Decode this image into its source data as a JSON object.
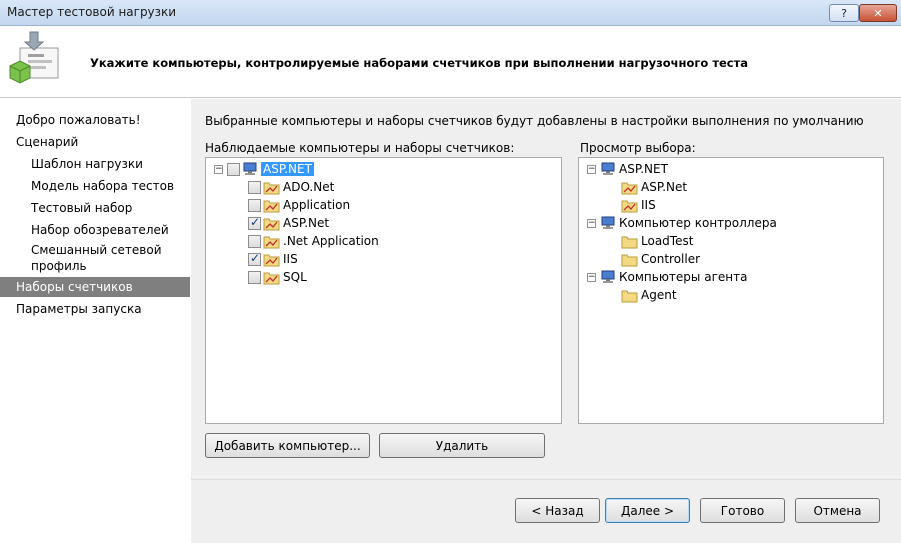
{
  "window": {
    "title": "Мастер тестовой нагрузки",
    "help_label": "?",
    "close_label": "✕"
  },
  "header": {
    "heading": "Укажите компьютеры, контролируемые наборами счетчиков при выполнении нагрузочного теста"
  },
  "nav": {
    "items": [
      {
        "label": "Добро пожаловать!"
      },
      {
        "label": "Сценарий"
      },
      {
        "label": "Шаблон нагрузки"
      },
      {
        "label": "Модель набора тестов"
      },
      {
        "label": "Тестовый набор"
      },
      {
        "label": "Набор обозревателей"
      },
      {
        "label": "Смешанный сетевой"
      },
      {
        "label": "профиль"
      },
      {
        "label": "Наборы счетчиков"
      },
      {
        "label": "Параметры запуска"
      }
    ]
  },
  "main": {
    "description": "Выбранные компьютеры и наборы счетчиков будут добавлены в настройки выполнения по умолчанию",
    "left_label": "Наблюдаемые компьютеры и наборы счетчиков:",
    "right_label": "Просмотр выбора:",
    "left_tree": {
      "root": "ASP.NET",
      "children": [
        {
          "label": "ADO.Net",
          "checked": false
        },
        {
          "label": "Application",
          "checked": false
        },
        {
          "label": "ASP.Net",
          "checked": true
        },
        {
          "label": ".Net Application",
          "checked": false
        },
        {
          "label": "IIS",
          "checked": true
        },
        {
          "label": "SQL",
          "checked": false
        }
      ]
    },
    "right_tree": {
      "nodes": [
        {
          "label": "ASP.NET",
          "children": [
            "ASP.Net",
            "IIS"
          ]
        },
        {
          "label": "Компьютер контроллера",
          "children": [
            "LoadTest",
            "Controller"
          ]
        },
        {
          "label": "Компьютеры агента",
          "children": [
            "Agent"
          ]
        }
      ]
    },
    "add_computer_label": "Добавить компьютер...",
    "delete_label": "Удалить"
  },
  "footer": {
    "back_label": "< Назад",
    "next_label": "Далее >",
    "finish_label": "Готово",
    "cancel_label": "Отмена"
  },
  "colors": {
    "selection": "#3399ff",
    "nav_selected": "#7f7f7f",
    "panel_bg": "#efefef"
  },
  "icons": [
    "wizard-icon",
    "computer-icon",
    "folder-counter-icon",
    "expander-icon"
  ]
}
